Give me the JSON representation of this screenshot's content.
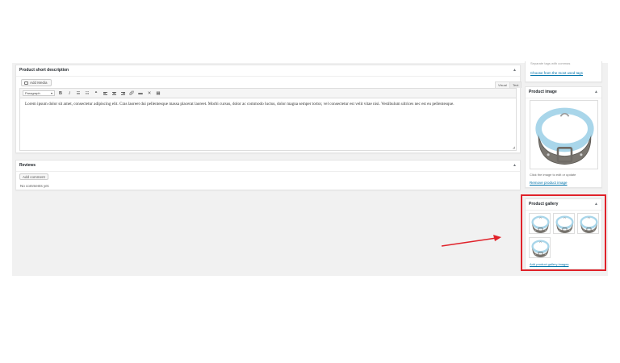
{
  "short_description": {
    "title": "Product short description",
    "add_media_label": "Add Media",
    "tab_visual": "Visual",
    "tab_text": "Text",
    "format_select_value": "Paragraph",
    "content": "Lorem ipsum dolor sit amet, consectetur adipiscing elit. Cras laoreet dui pellentesque massa placerat laoreet. Morbi cursus, dolor ac commodo luctus, dolor magna semper tortor, vel consectetur est velit vitae nisi. Vestibulum ultrices nec est eu pellentesque."
  },
  "reviews": {
    "title": "Reviews",
    "add_comment_label": "Add comment",
    "empty_text": "No comments yet."
  },
  "sidebar": {
    "tags_hint": "Separate tags with commas",
    "tags_link": "Choose from the most used tags",
    "product_image": {
      "title": "Product image",
      "hint": "Click the image to edit or update",
      "remove_link": "Remove product image"
    },
    "product_gallery": {
      "title": "Product gallery",
      "add_link": "Add product gallery images",
      "image_count": 4
    }
  },
  "colors": {
    "canvas_bg": "#f1f1f1",
    "link": "#0073aa",
    "annotation_red": "#e0222a",
    "collar_strap": "#7a7670",
    "collar_lining": "#a9d6ea"
  },
  "icons": {
    "toggle": "triangle-up-icon",
    "media": "camera-icon",
    "resize": "resize-grip-icon"
  }
}
